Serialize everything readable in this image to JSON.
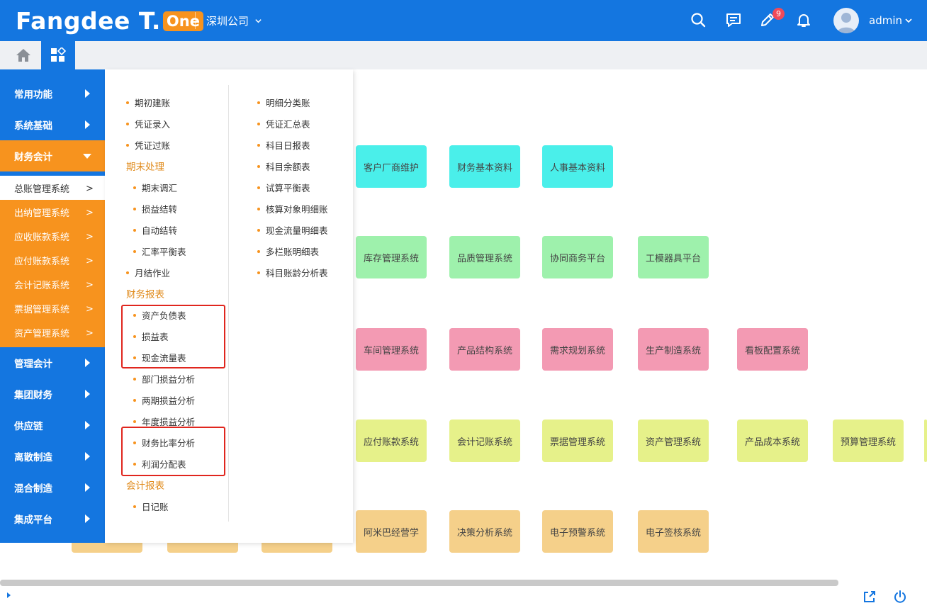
{
  "header": {
    "logo_text": "Fangdee T.",
    "logo_badge": "One",
    "company": "深圳公司",
    "notification_badge": "9",
    "username": "admin",
    "colors": {
      "primary": "#1476e0",
      "accent": "#f7931e",
      "badge": "#f04a5a"
    },
    "icons": [
      "search-icon",
      "message-icon",
      "edit-icon",
      "bell-icon",
      "user-avatar",
      "chevron-down-icon"
    ]
  },
  "sidebar": {
    "items": [
      {
        "label": "常用功能"
      },
      {
        "label": "系统基础"
      },
      {
        "label": "财务会计",
        "expanded": true
      },
      {
        "label": "管理会计"
      },
      {
        "label": "集团财务"
      },
      {
        "label": "供应链"
      },
      {
        "label": "离散制造"
      },
      {
        "label": "混合制造"
      },
      {
        "label": "集成平台"
      }
    ],
    "sub_items": [
      {
        "label": "总账管理系统",
        "selected": true
      },
      {
        "label": "出纳管理系统"
      },
      {
        "label": "应收账款系统"
      },
      {
        "label": "应付账款系统"
      },
      {
        "label": "会计记账系统"
      },
      {
        "label": "票据管理系统"
      },
      {
        "label": "资产管理系统"
      }
    ]
  },
  "menu": {
    "col1": [
      {
        "type": "link",
        "label": "期初建账"
      },
      {
        "type": "link",
        "label": "凭证录入"
      },
      {
        "type": "link",
        "label": "凭证过账"
      },
      {
        "type": "heading",
        "label": "期末处理"
      },
      {
        "type": "link",
        "label": "期末调汇"
      },
      {
        "type": "link",
        "label": "损益结转"
      },
      {
        "type": "link",
        "label": "自动结转"
      },
      {
        "type": "link",
        "label": "汇率平衡表"
      },
      {
        "type": "link",
        "label": "月结作业"
      },
      {
        "type": "heading",
        "label": "财务报表"
      },
      {
        "type": "link",
        "label": "资产负债表"
      },
      {
        "type": "link",
        "label": "损益表"
      },
      {
        "type": "link",
        "label": "现金流量表"
      },
      {
        "type": "link",
        "label": "部门损益分析"
      },
      {
        "type": "link",
        "label": "两期损益分析"
      },
      {
        "type": "link",
        "label": "年度损益分析"
      },
      {
        "type": "link",
        "label": "财务比率分析"
      },
      {
        "type": "link",
        "label": "利润分配表"
      },
      {
        "type": "heading",
        "label": "会计报表"
      },
      {
        "type": "link",
        "label": "日记账"
      }
    ],
    "col2": [
      {
        "label": "明细分类账"
      },
      {
        "label": "凭证汇总表"
      },
      {
        "label": "科目日报表"
      },
      {
        "label": "科目余额表"
      },
      {
        "label": "试算平衡表"
      },
      {
        "label": "核算对象明细账"
      },
      {
        "label": "现金流量明细表"
      },
      {
        "label": "多栏账明细表"
      },
      {
        "label": "科目账龄分析表"
      }
    ]
  },
  "tiles": {
    "cyan": [
      "客户厂商维护",
      "财务基本资料",
      "人事基本资料"
    ],
    "green": [
      "库存管理系统",
      "品质管理系统",
      "协同商务平台",
      "工模器具平台"
    ],
    "pink": [
      "车间管理系统",
      "产品结构系统",
      "需求规划系统",
      "生产制造系统",
      "看板配置系统"
    ],
    "yellow": [
      "应付账款系统",
      "会计记账系统",
      "票据管理系统",
      "资产管理系统",
      "产品成本系统",
      "预算管理系统"
    ],
    "orange": [
      "阿米巴经营学",
      "决策分析系统",
      "电子预警系统",
      "电子签核系统"
    ]
  }
}
